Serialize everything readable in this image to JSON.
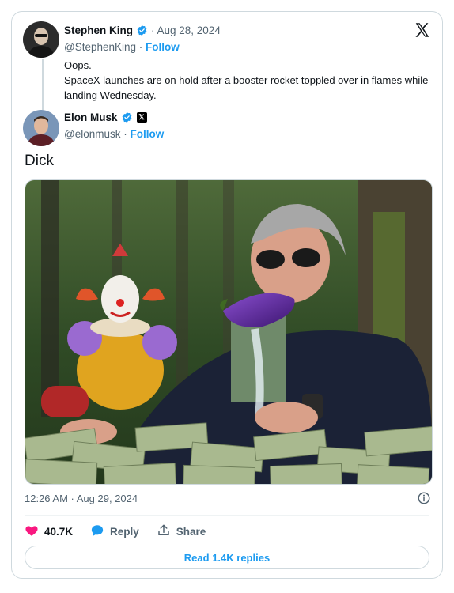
{
  "quoted": {
    "name": "Stephen King",
    "date": "· Aug 28, 2024",
    "handle": "@StephenKing",
    "dot": "·",
    "follow": "Follow",
    "lines": [
      "Oops.",
      "SpaceX launches are on hold after a booster rocket toppled over in flames while landing Wednesday."
    ]
  },
  "author": {
    "name": "Elon Musk",
    "handle": "@elonmusk",
    "dot": "·",
    "follow": "Follow",
    "affiliate_icon": "x-logo-icon"
  },
  "post": {
    "text": "Dick",
    "timestamp": "12:26 AM · Aug 29, 2024"
  },
  "actions": {
    "likes": "40.7K",
    "reply": "Reply",
    "share": "Share"
  },
  "read_replies": "Read 1.4K replies",
  "colors": {
    "accent": "#1d9bf0",
    "like": "#f91880",
    "border": "#cfd9de",
    "text": "#0f1419",
    "muted": "#536471"
  },
  "icons": [
    "verified-badge-icon",
    "x-logo-icon",
    "info-icon",
    "heart-icon",
    "reply-bubble-icon",
    "share-icon"
  ]
}
